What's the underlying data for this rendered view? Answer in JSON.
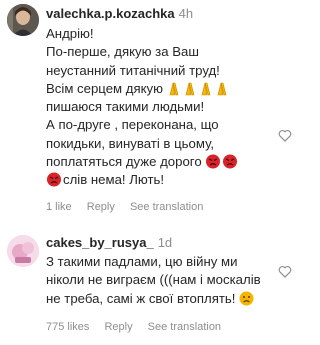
{
  "comments": [
    {
      "username": "valechka.p.kozachka",
      "time": "4h",
      "lines": [
        "Андрію!",
        "По-перше, дякую за Ваш",
        "неустанний титанічний труд!",
        "Всім серцем дякую",
        "пишаюся такими людьми!",
        "А по-друге , переконана, що",
        "покидьки, винуваті в цьому,",
        "поплатяться дуже дорого",
        "слів нема! Лють!"
      ],
      "likes": "1 like",
      "reply": "Reply",
      "see_translation": "See translation"
    },
    {
      "username": "cakes_by_rusya_",
      "time": "1d",
      "lines": [
        "З такими падлами, цю війну ми",
        "ніколи не виграєм (((нам і москалів",
        "не треба, самі ж свої втоплять!"
      ],
      "likes": "775 likes",
      "reply": "Reply",
      "see_translation": "See translation"
    }
  ],
  "icons": {
    "like": "heart-icon",
    "pray": "folded-hands-emoji",
    "angry": "angry-face-emoji",
    "sad": "frowning-face-emoji"
  },
  "colors": {
    "text": "#262626",
    "secondary": "#8e8e8e",
    "angry": "#d8232a",
    "emoji_yellow": "#f5b400"
  }
}
